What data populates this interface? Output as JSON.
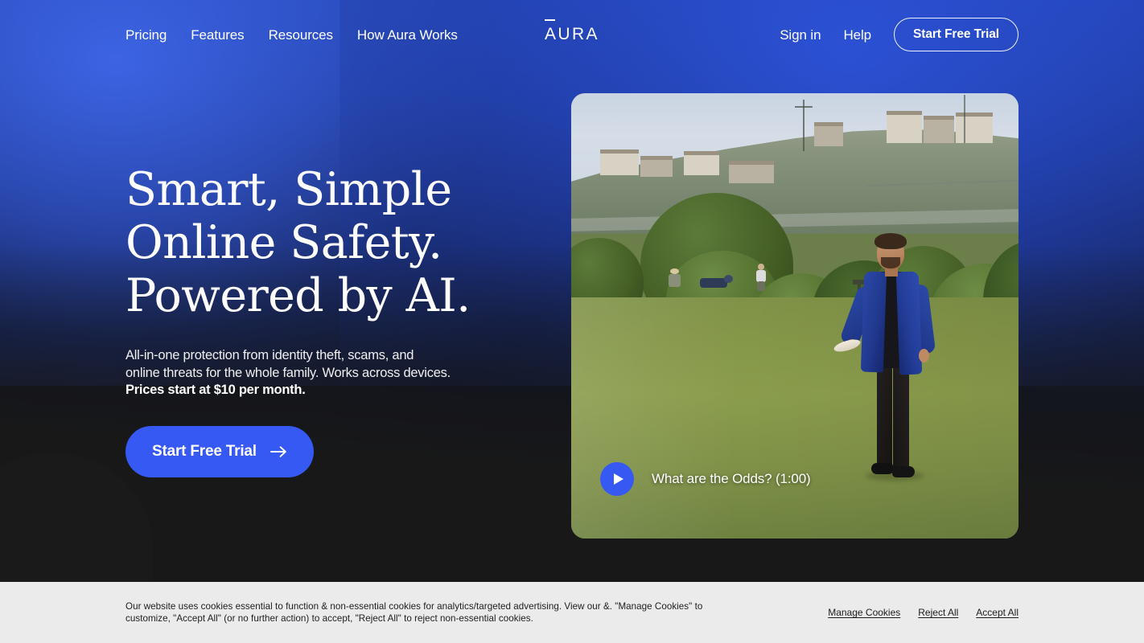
{
  "header": {
    "nav_left": [
      {
        "label": "Pricing"
      },
      {
        "label": "Features"
      },
      {
        "label": "Resources"
      },
      {
        "label": "How Aura Works"
      }
    ],
    "logo": "AURA",
    "nav_right": [
      {
        "label": "Sign in"
      },
      {
        "label": "Help"
      }
    ],
    "cta_label": "Start Free Trial"
  },
  "hero": {
    "title_line1": "Smart, Simple",
    "title_line2": "Online Safety.",
    "title_line3": "Powered by AI.",
    "sub_line1": "All-in-one protection from identity theft, scams, and",
    "sub_line2": "online threats for the whole family. Works across devices.",
    "sub_bold": "Prices start at $10 per month.",
    "cta_label": "Start Free Trial",
    "cta_arrow_icon": "arrow-right-icon"
  },
  "video": {
    "play_icon": "play-icon",
    "label": "What are the Odds? (1:00)"
  },
  "cookies": {
    "text": "Our website uses cookies essential to function & non-essential cookies for analytics/targeted advertising. View our &. \"Manage Cookies\" to customize, \"Accept All\" (or no further action) to accept, \"Reject All\" to reject non-essential cookies.",
    "actions": [
      {
        "label": "Manage Cookies"
      },
      {
        "label": "Reject All"
      },
      {
        "label": "Accept All"
      }
    ]
  },
  "colors": {
    "accent_blue": "#3659f3",
    "hero_blue_top": "#2546b4",
    "hero_dark": "#181818",
    "cookie_bg": "#ebebeb"
  }
}
